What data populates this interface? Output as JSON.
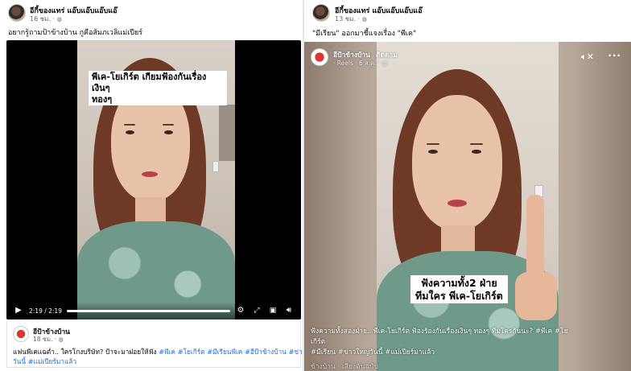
{
  "left_post": {
    "page_name": "อีกี้ของแทร่ แอ๊บแอ๊บแอ๊บแอ๊",
    "time": "16 ชม. · ",
    "caption": "อยากรู้ถามป้าข้างบ้าน กูคือส้มภเวลิแม่เปียร์",
    "video": {
      "overlay_text_line1": "พีเค-โยเกิร์ต เกียมฟ้องกันเรื่องเงินๆ",
      "overlay_text_line2": "ทองๆ",
      "time_label": "2:19 / 2:19",
      "progress_fraction": 1.0
    },
    "shared_page_name": "อีป้าข้างบ้าน",
    "shared_time": "18 ชม. · ",
    "shared_caption_text": "แฟนพีเคแฉต่ำ.. ใครโกงบริษัท? ป้าจะมาฝอยให้ฟัง ",
    "shared_hashtags_line1": "#พีเค #โยเกิร์ต #มีเรียนพีเค #อีป้าข้างบ้าน #ข่าวใหญ่",
    "shared_hashtags_line2": "วันนี้ #แม่เปียร์มาแล้ว"
  },
  "right_post": {
    "page_name": "อีกี้ของแทร่ แอ๊บแอ๊บแอ๊บแอ๊",
    "time": "13 ชม. · ",
    "caption": "\"มีเรียน\" ออกมาชี้แจงเรื่อง \"พีเค\"",
    "reel": {
      "page_name": "อีป้าข้างบ้าน",
      "follow_label": "ติดตาม",
      "meta": "· Reels · 6 ส.ค. · ",
      "overlay_line1": "ฟังความทั้ง2 ฝ่าย",
      "overlay_line2": "ทีมใคร พีเค-โยเกิร์ต",
      "caption_line1_text": "ฟังความทั้งสองฝ่าย.. พีเค-โยเกิร์ต ฟ้องร้องกันเรื่องเงินๆ ทองๆ ทีมใครกันนะ? ",
      "caption_line1_tags": "#พีเค #โยเกิร์ต",
      "caption_line2_tags": "#มีเรียน #ข่าวใหญ่วันนี้ #แม่เปียร์มาแล้ว",
      "audio_line": "ข้างบ้าน · เสียงต้นฉบับ"
    }
  },
  "icons": {
    "globe": "globe-icon",
    "play": "play-icon",
    "settings": "gear-icon",
    "fullscreen": "fullscreen-icon",
    "pip": "picture-in-picture-icon",
    "volume": "volume-icon",
    "mute": "mute-icon",
    "more": "more-icon"
  },
  "colors": {
    "link": "#216fdb",
    "meta": "#65676b",
    "text": "#050505"
  }
}
